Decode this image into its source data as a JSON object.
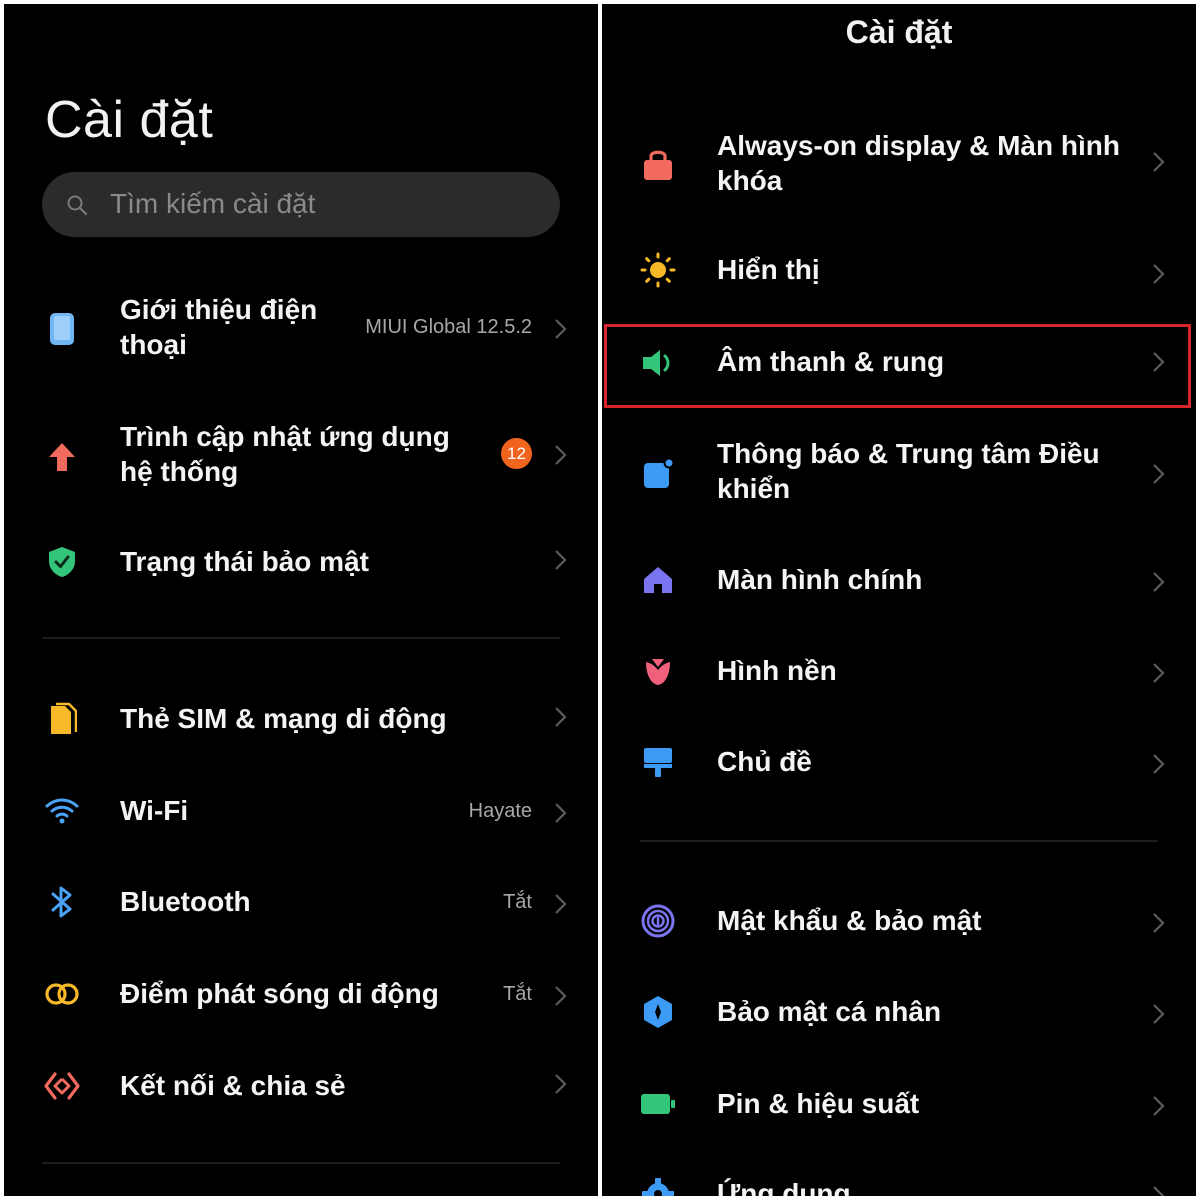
{
  "left": {
    "title": "Cài đặt",
    "search": {
      "placeholder": "Tìm kiếm cài đặt"
    },
    "items": [
      {
        "label": "Giới thiệu điện thoại",
        "value": "MIUI Global 12.5.2",
        "icon": "phone-icon"
      },
      {
        "label": "Trình cập nhật ứng dụng hệ thống",
        "badge": "12",
        "icon": "arrow-up-icon"
      },
      {
        "label": "Trạng thái bảo mật",
        "icon": "shield-check-icon"
      },
      {
        "label": "Thẻ SIM & mạng di động",
        "icon": "sim-card-icon"
      },
      {
        "label": "Wi-Fi",
        "value": "Hayate",
        "icon": "wifi-icon"
      },
      {
        "label": "Bluetooth",
        "value": "Tắt",
        "icon": "bluetooth-icon"
      },
      {
        "label": "Điểm phát sóng di động",
        "value": "Tắt",
        "icon": "hotspot-icon"
      },
      {
        "label": "Kết nối & chia sẻ",
        "icon": "connection-share-icon"
      }
    ]
  },
  "right": {
    "title": "Cài đặt",
    "items": [
      {
        "label": "Always-on display & Màn hình khóa",
        "icon": "lock-icon"
      },
      {
        "label": "Hiển thị",
        "icon": "sun-icon"
      },
      {
        "label": "Âm thanh & rung",
        "icon": "speaker-icon"
      },
      {
        "label": "Thông báo & Trung tâm Điều khiển",
        "icon": "notification-icon"
      },
      {
        "label": "Màn hình chính",
        "icon": "home-icon"
      },
      {
        "label": "Hình nền",
        "icon": "wallpaper-flower-icon"
      },
      {
        "label": "Chủ đề",
        "icon": "theme-brush-icon"
      },
      {
        "label": "Mật khẩu & bảo mật",
        "icon": "fingerprint-icon"
      },
      {
        "label": "Bảo mật cá nhân",
        "icon": "privacy-icon"
      },
      {
        "label": "Pin & hiệu suất",
        "icon": "battery-icon"
      },
      {
        "label": "Ứng dụng",
        "icon": "gear-icon"
      }
    ]
  },
  "colors": {
    "background": "#000000",
    "highlight_border": "#d6262c",
    "badge": "#f0641e"
  }
}
